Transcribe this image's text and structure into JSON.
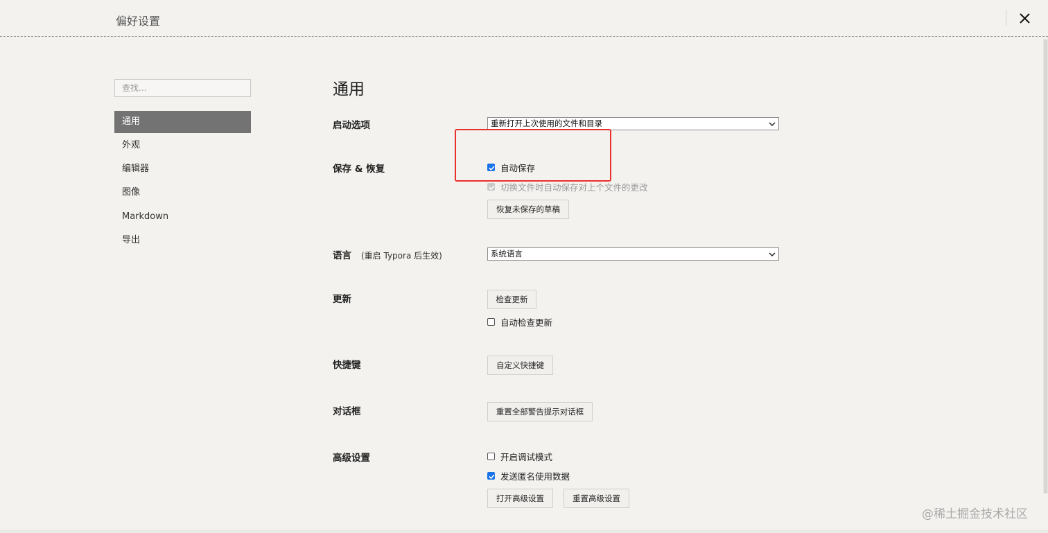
{
  "window": {
    "title": "偏好设置",
    "close_icon": "close-icon"
  },
  "sidebar": {
    "search_placeholder": "查找...",
    "items": [
      {
        "label": "通用",
        "active": true
      },
      {
        "label": "外观"
      },
      {
        "label": "编辑器"
      },
      {
        "label": "图像"
      },
      {
        "label": "Markdown"
      },
      {
        "label": "导出"
      }
    ]
  },
  "main": {
    "title": "通用",
    "startup": {
      "label": "启动选项",
      "selected": "重新打开上次使用的文件和目录"
    },
    "save_restore": {
      "label": "保存 & 恢复",
      "auto_save": {
        "label": "自动保存",
        "checked": true
      },
      "save_on_switch": {
        "label": "切换文件时自动保存对上个文件的更改",
        "checked": true,
        "disabled": true
      },
      "restore_button": "恢复未保存的草稿"
    },
    "language": {
      "label": "语言",
      "note": "(重启 Typora 后生效)",
      "selected": "系统语言"
    },
    "update": {
      "label": "更新",
      "check_button": "检查更新",
      "auto_check": {
        "label": "自动检查更新",
        "checked": false
      }
    },
    "shortcuts": {
      "label": "快捷键",
      "button": "自定义快捷键"
    },
    "dialogs": {
      "label": "对话框",
      "button": "重置全部警告提示对话框"
    },
    "advanced": {
      "label": "高级设置",
      "debug_mode": {
        "label": "开启调试模式",
        "checked": false
      },
      "send_usage": {
        "label": "发送匿名使用数据",
        "checked": true
      },
      "open_button": "打开高级设置",
      "reset_button": "重置高级设置"
    }
  },
  "watermark": "@稀土掘金技术社区",
  "accent_color": "#1a73e8",
  "highlight_color": "#e8302c"
}
